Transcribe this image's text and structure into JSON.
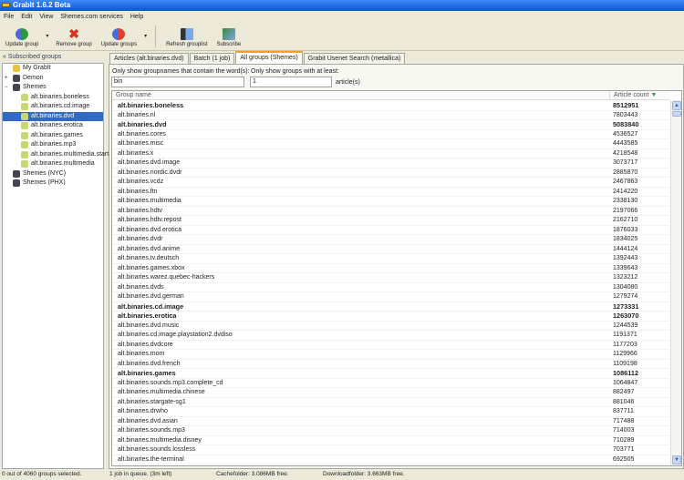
{
  "window": {
    "title": "GrabIt 1.6.2 Beta"
  },
  "menu": [
    "File",
    "Edit",
    "View",
    "Shemes.com services",
    "Help"
  ],
  "toolbar": {
    "update_group": "Update group",
    "remove_group": "Remove group",
    "update_groups": "Update groups",
    "refresh_grouplist": "Refresh grouplist",
    "subscribe": "Subscribe",
    "dropdown": "▾"
  },
  "sidebar": {
    "header": "«  Subscribed groups",
    "nodes": [
      {
        "label": "My GrabIt",
        "level": 0,
        "expander": ""
      },
      {
        "label": "Demon",
        "level": 0,
        "expander": "+"
      },
      {
        "label": "Shemes",
        "level": 0,
        "expander": "−"
      },
      {
        "label": "alt.binaries.boneless",
        "level": 1
      },
      {
        "label": "alt.binaries.cd.image",
        "level": 1
      },
      {
        "label": "alt.binaries.dvd",
        "level": 1,
        "selected": true
      },
      {
        "label": "alt.binaries.erotica",
        "level": 1
      },
      {
        "label": "alt.binaries.games",
        "level": 1
      },
      {
        "label": "alt.binaries.mp3",
        "level": 1
      },
      {
        "label": "alt.binaries.multimedia.startrek",
        "level": 1
      },
      {
        "label": "alt.binaries.multimedia",
        "level": 1
      },
      {
        "label": "Shemes (NYC)",
        "level": 0,
        "expander": ""
      },
      {
        "label": "Shemes (PHX)",
        "level": 0,
        "expander": ""
      }
    ]
  },
  "tabs": [
    "Articles (alt.binaries.dvd)",
    "Batch (1 job)",
    "All groups (Shemes)",
    "Grabit Usenet Search (metallica)"
  ],
  "active_tab": 2,
  "filter": {
    "name_label": "Only show groupnames that contain the word(s):",
    "name_value": "bin",
    "min_label": "Only show groups with at least:",
    "min_value": "1",
    "min_suffix": "article(s)"
  },
  "table": {
    "col_name": "Group name",
    "col_count": "Article count",
    "sort_icon": "▼",
    "rows": [
      [
        "alt.binaries.boneless",
        "8512951",
        1
      ],
      [
        "alt.binaries.nl",
        "7803443",
        0
      ],
      [
        "alt.binaries.dvd",
        "5083840",
        1
      ],
      [
        "alt.binaries.cores",
        "4536527",
        0
      ],
      [
        "alt.binaries.misc",
        "4443585",
        0
      ],
      [
        "alt.binaries.x",
        "4218548",
        0
      ],
      [
        "alt.binaries.dvd.image",
        "3073717",
        0
      ],
      [
        "alt.binaries.nordic.dvdr",
        "2885870",
        0
      ],
      [
        "alt.binaries.vcdz",
        "2467863",
        0
      ],
      [
        "alt.binaries.ftn",
        "2414220",
        0
      ],
      [
        "alt.binaries.multimedia",
        "2338130",
        0
      ],
      [
        "alt.binaries.hdtv",
        "2197066",
        0
      ],
      [
        "alt.binaries.hdtv.repost",
        "2162710",
        0
      ],
      [
        "alt.binaries.dvd.erotica",
        "1876033",
        0
      ],
      [
        "alt.binaries.dvdr",
        "1834025",
        0
      ],
      [
        "alt.binaries.dvd.anime",
        "1444124",
        0
      ],
      [
        "alt.binaries.tv.deutsch",
        "1392443",
        0
      ],
      [
        "alt.binaries.games.xbox",
        "1339643",
        0
      ],
      [
        "alt.binaries.warez.quebec-hackers",
        "1323212",
        0
      ],
      [
        "alt.binaries.dvds",
        "1304080",
        0
      ],
      [
        "alt.binaries.dvd.german",
        "1279274",
        0
      ],
      [
        "alt.binaries.cd.image",
        "1273331",
        1
      ],
      [
        "alt.binaries.erotica",
        "1263070",
        1
      ],
      [
        "alt.binaries.dvd.music",
        "1244539",
        0
      ],
      [
        "alt.binaries.cd.image.playstation2.dvdiso",
        "1191371",
        0
      ],
      [
        "alt.binaries.dvdcore",
        "1177203",
        0
      ],
      [
        "alt.binaries.mom",
        "1129966",
        0
      ],
      [
        "alt.binaries.dvd.french",
        "1109198",
        0
      ],
      [
        "alt.binaries.games",
        "1086112",
        1
      ],
      [
        "alt.binaries.sounds.mp3.complete_cd",
        "1064847",
        0
      ],
      [
        "alt.binaries.multimedia.chinese",
        "882497",
        0
      ],
      [
        "alt.binaries.stargate-sg1",
        "881046",
        0
      ],
      [
        "alt.binaries.drwho",
        "837711",
        0
      ],
      [
        "alt.binaries.dvd.asian",
        "717488",
        0
      ],
      [
        "alt.binaries.sounds.mp3",
        "714003",
        0
      ],
      [
        "alt.binaries.multimedia.disney",
        "710289",
        0
      ],
      [
        "alt.binaries.sounds.lossless",
        "703771",
        0
      ],
      [
        "alt.binaries.the-terminal",
        "692505",
        0
      ]
    ]
  },
  "status": {
    "selection": "0 out of 4060 groups selected.",
    "queue": "1 job in queue. (3m left)",
    "cache": "Cachefolder: 3.086MB free.",
    "download": "Downloadfolder: 3.663MB free."
  }
}
